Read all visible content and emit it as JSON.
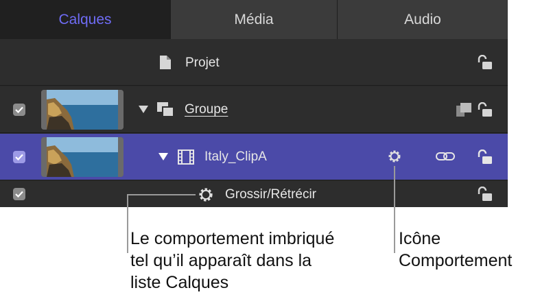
{
  "tabs": [
    {
      "label": "Calques",
      "active": true
    },
    {
      "label": "Média",
      "active": false
    },
    {
      "label": "Audio",
      "active": false
    }
  ],
  "layers": {
    "projet": {
      "label": "Projet",
      "icon": "document-icon"
    },
    "groupe": {
      "label": "Groupe",
      "icon": "group-icon",
      "checked": true,
      "expanded": true
    },
    "clip": {
      "label": "Italy_ClipA",
      "icon": "film-icon",
      "checked": true,
      "expanded": true,
      "selected": true
    },
    "behavior": {
      "label": "Grossir/Rétrécir",
      "icon": "behavior-gear-icon",
      "checked": true
    }
  },
  "callouts": {
    "left": "Le comportement imbriqué\ntel qu’il apparaît dans la\nliste Calques",
    "right": "Icône\nComportement"
  },
  "colors": {
    "panel_bg": "#2d2d2d",
    "active_tab_text": "#6f6cf5",
    "selected_row": "#4b4aa8"
  }
}
